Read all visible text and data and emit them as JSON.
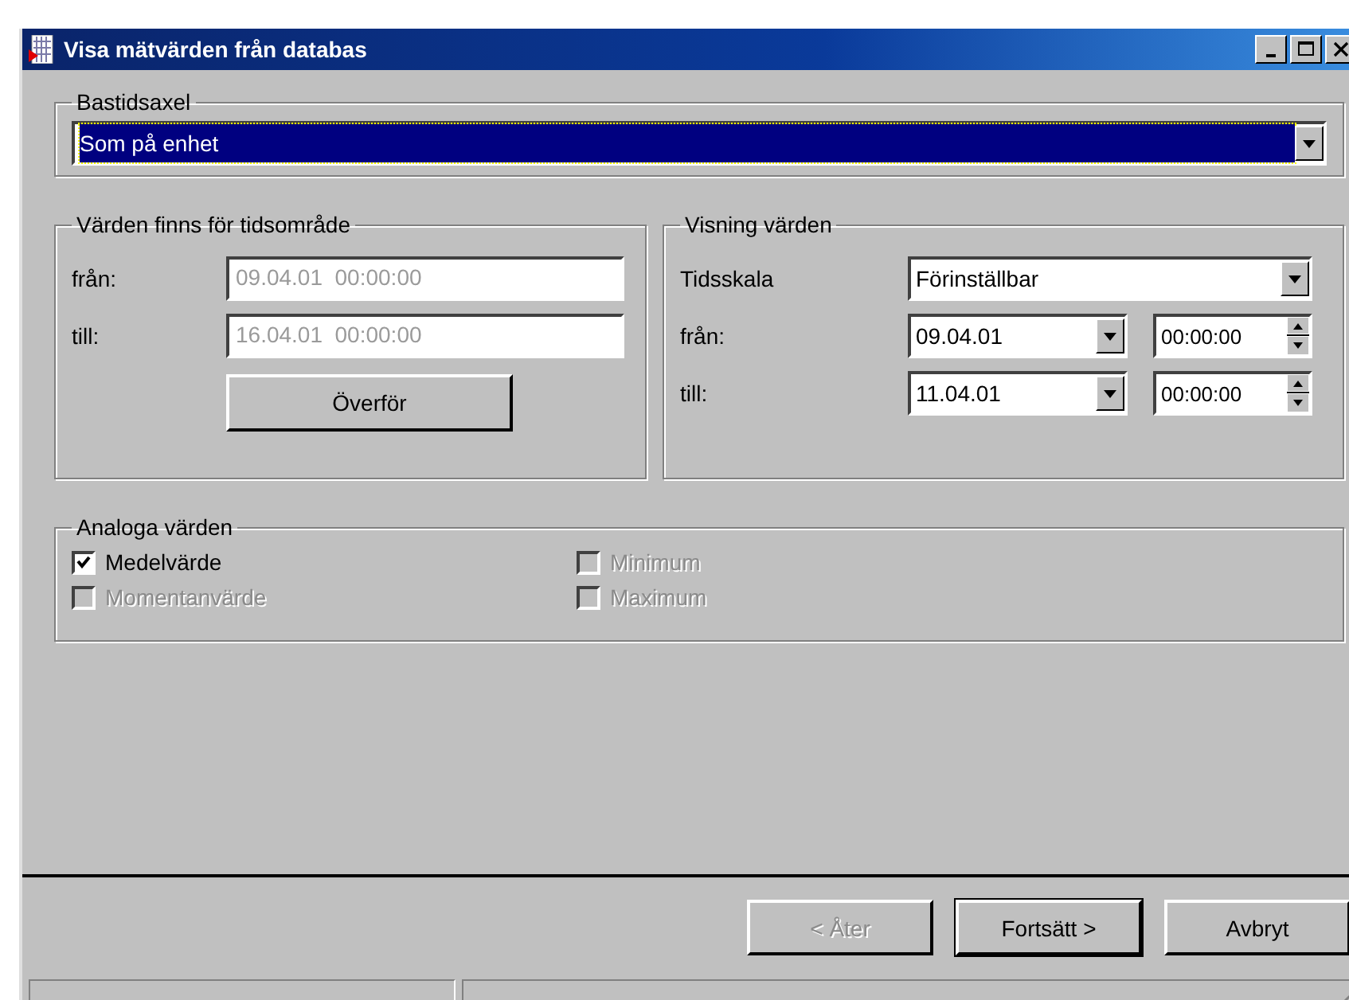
{
  "window": {
    "title": "Visa mätvärden från databas"
  },
  "base_axis": {
    "label": "Bastidsaxel",
    "value": "Som på enhet"
  },
  "available_range": {
    "label": "Värden finns för tidsområde",
    "fields": [
      {
        "label": "från:",
        "value": "09.04.01  00:00:00",
        "disabled": true
      },
      {
        "label": "till:",
        "value": "16.04.01  00:00:00",
        "disabled": true
      }
    ],
    "button": "Överför"
  },
  "display": {
    "label": "Visning värden",
    "scale_label": "Tidsskala",
    "scale_value": "Förinställbar",
    "rows": [
      {
        "label": "från:",
        "date": "09.04.01",
        "time": "00:00:00"
      },
      {
        "label": "till:",
        "date": "11.04.01",
        "time": "00:00:00"
      }
    ]
  },
  "analog": {
    "label": "Analoga värden",
    "checkboxes": [
      {
        "label": "Medelvärde",
        "checked": true,
        "disabled": false
      },
      {
        "label": "Minimum",
        "checked": false,
        "disabled": true
      },
      {
        "label": "Momentanvärde",
        "checked": false,
        "disabled": true
      },
      {
        "label": "Maximum",
        "checked": false,
        "disabled": true
      }
    ]
  },
  "buttons": [
    {
      "label": "< Åter",
      "disabled": true,
      "default": false
    },
    {
      "label": "Fortsätt >",
      "disabled": false,
      "default": true
    },
    {
      "label": "Avbryt",
      "disabled": false,
      "default": false
    }
  ]
}
